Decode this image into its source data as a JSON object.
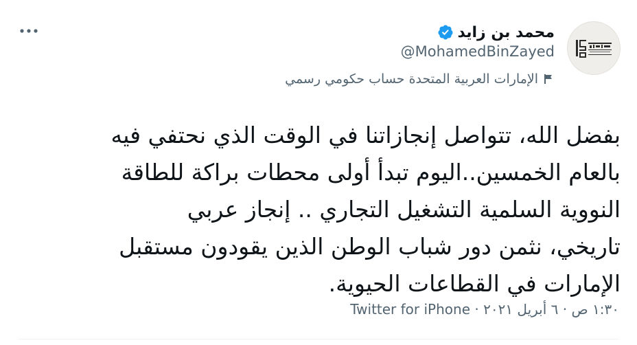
{
  "author": {
    "display_name": "محمد بن زايد",
    "handle": "@MohamedBinZayed",
    "verified": true,
    "verified_icon": "verified-badge-icon",
    "avatar_icon": "year-of-the-fiftieth-logo"
  },
  "account_label": {
    "icon": "flag-icon",
    "text": "الإمارات العربية المتحدة حساب حكومي رسمي"
  },
  "more_menu": {
    "icon": "more-dots-icon"
  },
  "tweet": {
    "lines": [
      "بفضل الله، تتواصل إنجازاتنا في الوقت الذي نحتفي فيه",
      "بالعام الخمسين..اليوم تبدأ أولى محطات براكة للطاقة",
      "النووية السلمية التشغيل التجاري .. إنجاز عربي",
      "تاريخي، نثمن دور شباب الوطن الذين يقودون مستقبل",
      "الإمارات في القطاعات الحيوية."
    ]
  },
  "meta": {
    "time": "١:٣٠ ص",
    "date": "٦ أبريل ٢٠٢١",
    "separator": "·",
    "source": "Twitter for iPhone"
  },
  "colors": {
    "text": "#0f1419",
    "secondary": "#536471",
    "verified": "#1d9bf0",
    "divider": "#eff3f4"
  }
}
